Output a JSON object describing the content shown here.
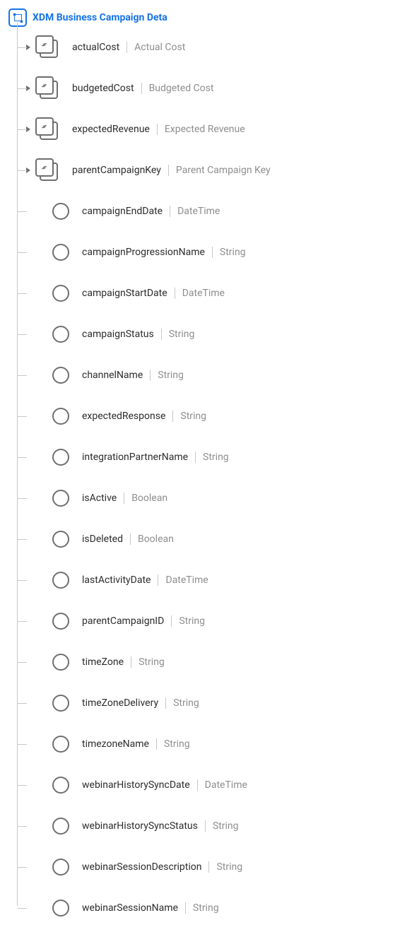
{
  "root": {
    "title": "XDM Business Campaign Deta"
  },
  "objects": [
    {
      "name": "actualCost",
      "display": "Actual Cost"
    },
    {
      "name": "budgetedCost",
      "display": "Budgeted Cost"
    },
    {
      "name": "expectedRevenue",
      "display": "Expected Revenue"
    },
    {
      "name": "parentCampaignKey",
      "display": "Parent Campaign Key"
    }
  ],
  "leaves": [
    {
      "name": "campaignEndDate",
      "type": "DateTime"
    },
    {
      "name": "campaignProgressionName",
      "type": "String"
    },
    {
      "name": "campaignStartDate",
      "type": "DateTime"
    },
    {
      "name": "campaignStatus",
      "type": "String"
    },
    {
      "name": "channelName",
      "type": "String"
    },
    {
      "name": "expectedResponse",
      "type": "String"
    },
    {
      "name": "integrationPartnerName",
      "type": "String"
    },
    {
      "name": "isActive",
      "type": "Boolean"
    },
    {
      "name": "isDeleted",
      "type": "Boolean"
    },
    {
      "name": "lastActivityDate",
      "type": "DateTime"
    },
    {
      "name": "parentCampaignID",
      "type": "String"
    },
    {
      "name": "timeZone",
      "type": "String"
    },
    {
      "name": "timeZoneDelivery",
      "type": "String"
    },
    {
      "name": "timezoneName",
      "type": "String"
    },
    {
      "name": "webinarHistorySyncDate",
      "type": "DateTime"
    },
    {
      "name": "webinarHistorySyncStatus",
      "type": "String"
    },
    {
      "name": "webinarSessionDescription",
      "type": "String"
    },
    {
      "name": "webinarSessionName",
      "type": "String"
    }
  ]
}
